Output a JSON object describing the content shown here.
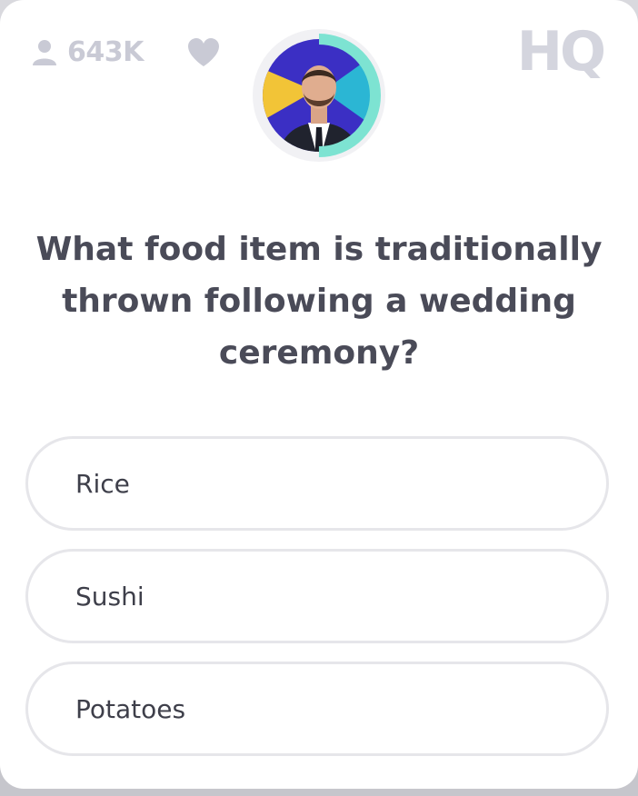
{
  "header": {
    "viewer_count": "643K",
    "logo": "HQ",
    "icons": {
      "viewers": "person-icon",
      "heart": "heart-icon"
    },
    "timer_ring_color": "#7de3d2",
    "timer_level": 0.5
  },
  "question": {
    "text": "What food item is traditionally thrown following a wedding ceremony?"
  },
  "answers": [
    {
      "label": "Rice"
    },
    {
      "label": "Sushi"
    },
    {
      "label": "Potatoes"
    }
  ],
  "colors": {
    "text": "#4a4b58",
    "muted": "#c9cad5",
    "answer_border": "#e6e6ea"
  }
}
